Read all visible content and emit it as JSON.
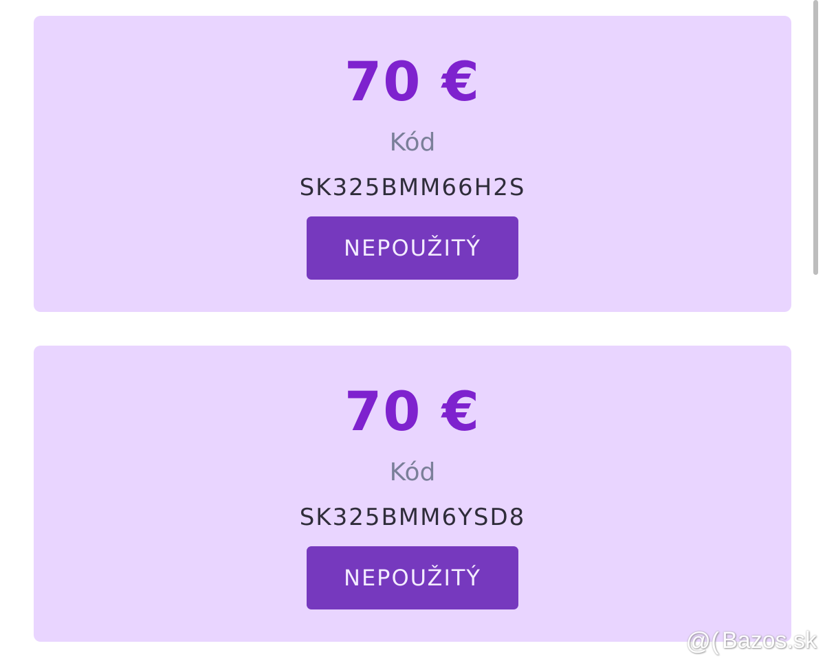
{
  "vouchers": [
    {
      "amount": "70 €",
      "code_label": "Kód",
      "code": "SK325BMM66H2S",
      "status": "NEPOUŽITÝ"
    },
    {
      "amount": "70 €",
      "code_label": "Kód",
      "code": "SK325BMM6YSD8",
      "status": "NEPOUŽITÝ"
    }
  ],
  "watermark": {
    "logo_glyph": "@(",
    "text": "Bazos.sk"
  },
  "colors": {
    "card_background": "#e9d5ff",
    "amount": "#7e22ce",
    "button": "#7639be",
    "label": "#7a7f99",
    "code": "#2f2d3a"
  }
}
